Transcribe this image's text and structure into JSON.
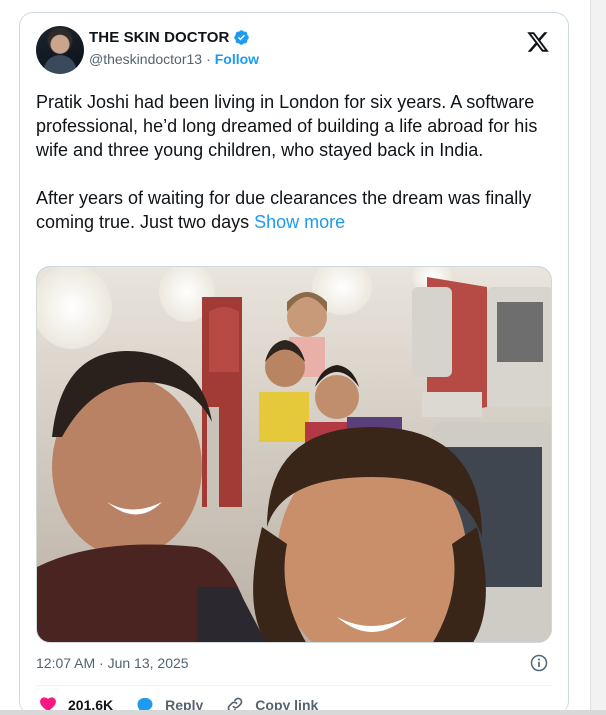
{
  "tweet": {
    "author_name": "THE SKIN DOCTOR",
    "handle": "@theskindoctor13",
    "separator": "·",
    "follow_label": "Follow",
    "text_p1": "Pratik Joshi had been living in London for six years. A software professional, he’d long dreamed of building a life abroad for his wife and three young children, who stayed back in India.",
    "text_p2": "After years of waiting for due clearances the dream was finally coming true. Just two days ",
    "show_more_label": "Show more",
    "timestamp": "12:07 AM · Jun 13, 2025"
  },
  "actions": {
    "like_count": "201.6K",
    "reply_label": "Reply",
    "copy_link_label": "Copy link"
  },
  "icons": {
    "verified": "verified-badge-icon",
    "x_logo": "x-logo-icon",
    "info": "info-icon",
    "heart": "heart-icon",
    "reply": "reply-icon",
    "link": "link-icon"
  },
  "colors": {
    "accent": "#1d9bf0",
    "like": "#f91880",
    "text": "#0f1419",
    "muted": "#536471"
  }
}
